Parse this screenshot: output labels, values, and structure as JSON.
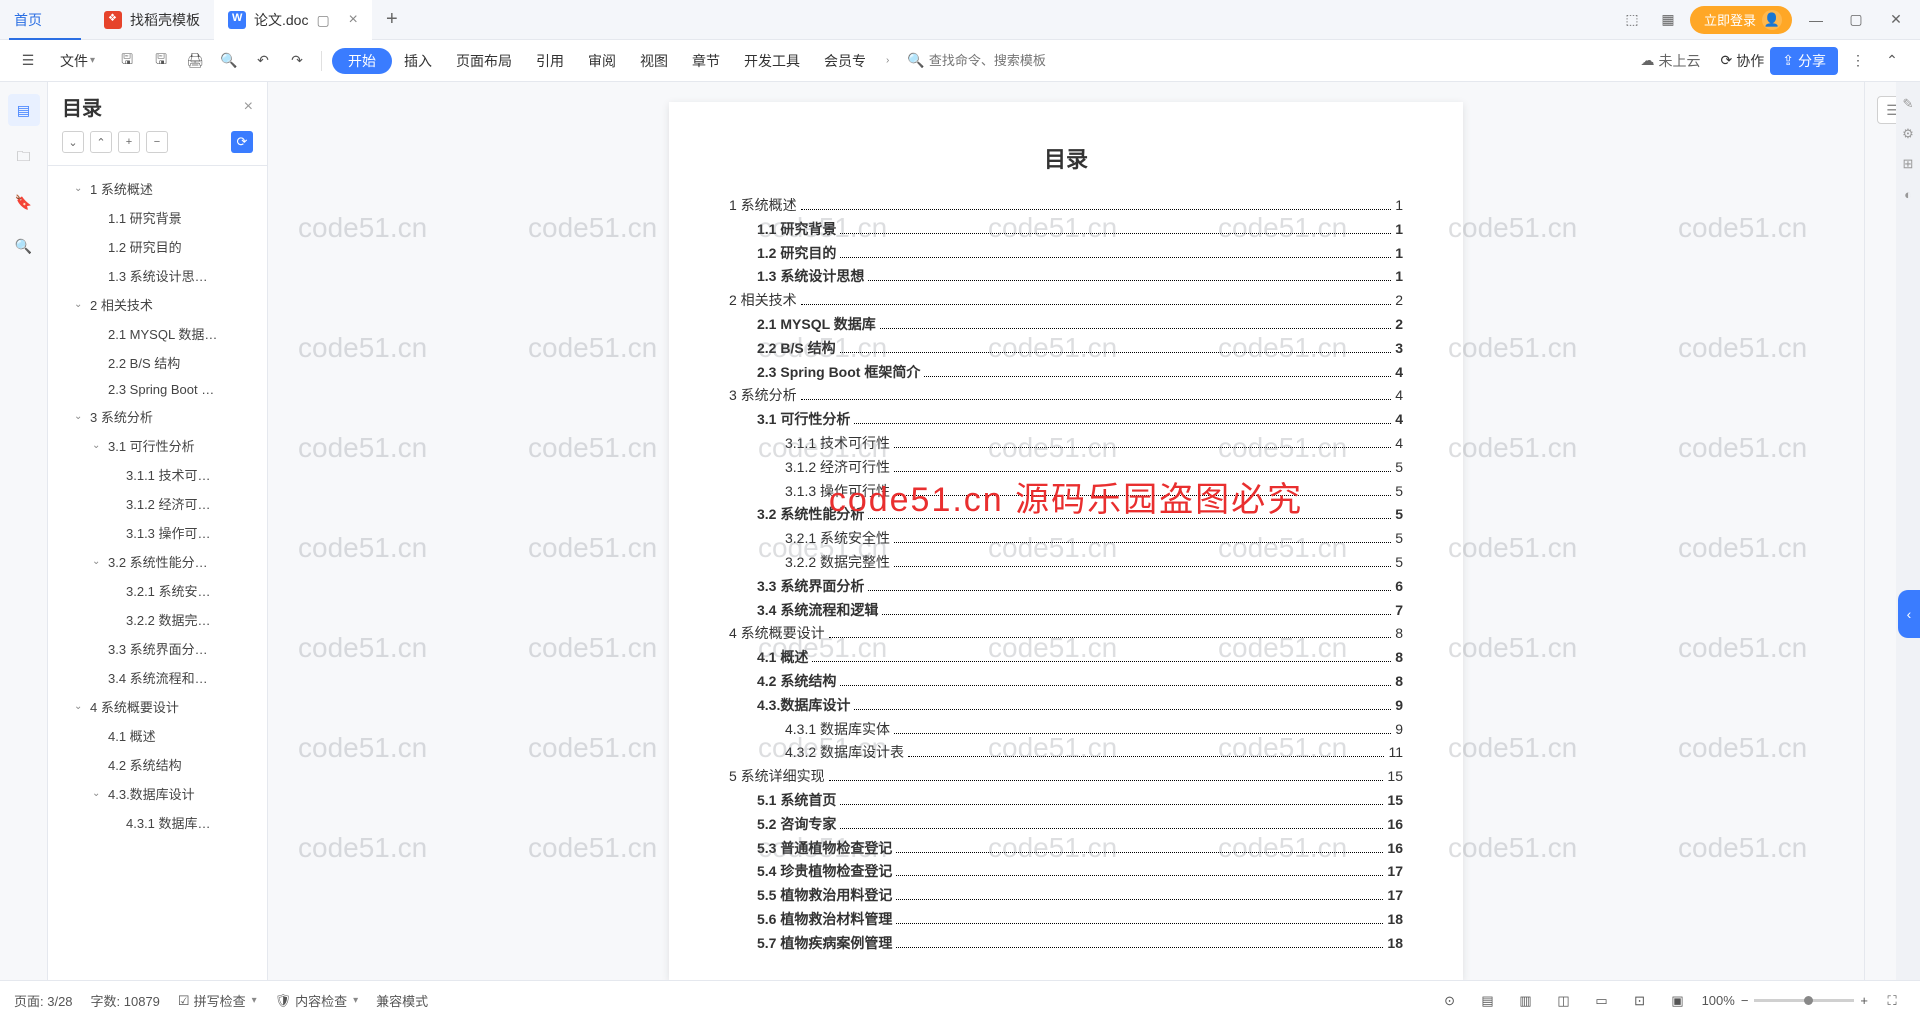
{
  "titlebar": {
    "home": "首页",
    "tab1": "找稻壳模板",
    "tab2": "论文.doc",
    "login": "立即登录"
  },
  "toolbar": {
    "file": "文件",
    "menus": [
      "开始",
      "插入",
      "页面布局",
      "引用",
      "审阅",
      "视图",
      "章节",
      "开发工具",
      "会员专"
    ],
    "search_placeholder": "查找命令、搜索模板",
    "cloud": "未上云",
    "collab": "协作",
    "share": "分享"
  },
  "outline": {
    "title": "目录",
    "items": [
      {
        "lvl": 0,
        "caret": true,
        "text": "1 系统概述"
      },
      {
        "lvl": 1,
        "text": "1.1 研究背景"
      },
      {
        "lvl": 1,
        "text": "1.2 研究目的"
      },
      {
        "lvl": 1,
        "text": "1.3 系统设计思…"
      },
      {
        "lvl": 0,
        "caret": true,
        "text": "2 相关技术"
      },
      {
        "lvl": 1,
        "text": "2.1 MYSQL 数据…"
      },
      {
        "lvl": 1,
        "text": "2.2 B/S 结构"
      },
      {
        "lvl": 1,
        "text": "2.3 Spring Boot …"
      },
      {
        "lvl": 0,
        "caret": true,
        "text": "3 系统分析"
      },
      {
        "lvl": 1,
        "caret": true,
        "text": "3.1 可行性分析"
      },
      {
        "lvl": 2,
        "text": "3.1.1 技术可…"
      },
      {
        "lvl": 2,
        "text": "3.1.2 经济可…"
      },
      {
        "lvl": 2,
        "text": "3.1.3 操作可…"
      },
      {
        "lvl": 1,
        "caret": true,
        "text": "3.2 系统性能分…"
      },
      {
        "lvl": 2,
        "text": "3.2.1 系统安…"
      },
      {
        "lvl": 2,
        "text": "3.2.2 数据完…"
      },
      {
        "lvl": 1,
        "text": "3.3 系统界面分…"
      },
      {
        "lvl": 1,
        "text": "3.4 系统流程和…"
      },
      {
        "lvl": 0,
        "caret": true,
        "text": "4 系统概要设计"
      },
      {
        "lvl": 1,
        "text": "4.1 概述"
      },
      {
        "lvl": 1,
        "text": "4.2 系统结构"
      },
      {
        "lvl": 1,
        "caret": true,
        "text": "4.3.数据库设计"
      },
      {
        "lvl": 2,
        "text": "4.3.1 数据库…"
      }
    ]
  },
  "doc": {
    "title": "目录",
    "toc": [
      {
        "lvl": 1,
        "t": "1 系统概述",
        "p": "1"
      },
      {
        "lvl": 2,
        "t": "1.1 研究背景",
        "p": "1"
      },
      {
        "lvl": 2,
        "t": "1.2 研究目的",
        "p": "1"
      },
      {
        "lvl": 2,
        "t": "1.3 系统设计思想",
        "p": "1"
      },
      {
        "lvl": 1,
        "t": "2 相关技术",
        "p": "2"
      },
      {
        "lvl": 2,
        "t": "2.1 MYSQL 数据库",
        "p": "2"
      },
      {
        "lvl": 2,
        "t": "2.2 B/S 结构",
        "p": "3"
      },
      {
        "lvl": 2,
        "t": "2.3 Spring Boot 框架简介",
        "p": "4"
      },
      {
        "lvl": 1,
        "t": "3 系统分析",
        "p": "4"
      },
      {
        "lvl": 2,
        "t": "3.1 可行性分析",
        "p": "4"
      },
      {
        "lvl": 3,
        "t": "3.1.1 技术可行性",
        "p": "4"
      },
      {
        "lvl": 3,
        "t": "3.1.2 经济可行性",
        "p": "5"
      },
      {
        "lvl": 3,
        "t": "3.1.3 操作可行性",
        "p": "5"
      },
      {
        "lvl": 2,
        "t": "3.2 系统性能分析",
        "p": "5"
      },
      {
        "lvl": 3,
        "t": "3.2.1 系统安全性",
        "p": "5"
      },
      {
        "lvl": 3,
        "t": "3.2.2 数据完整性",
        "p": "5"
      },
      {
        "lvl": 2,
        "t": "3.3 系统界面分析",
        "p": "6"
      },
      {
        "lvl": 2,
        "t": "3.4 系统流程和逻辑",
        "p": "7"
      },
      {
        "lvl": 1,
        "t": "4 系统概要设计",
        "p": "8"
      },
      {
        "lvl": 2,
        "t": "4.1 概述",
        "p": "8"
      },
      {
        "lvl": 2,
        "t": "4.2 系统结构",
        "p": "8"
      },
      {
        "lvl": 2,
        "t": "4.3.数据库设计",
        "p": "9"
      },
      {
        "lvl": 3,
        "t": "4.3.1 数据库实体",
        "p": "9"
      },
      {
        "lvl": 3,
        "t": "4.3.2 数据库设计表",
        "p": "11"
      },
      {
        "lvl": 1,
        "t": "5 系统详细实现",
        "p": "15"
      },
      {
        "lvl": 2,
        "t": "5.1 系统首页",
        "p": "15"
      },
      {
        "lvl": 2,
        "t": "5.2 咨询专家",
        "p": "16"
      },
      {
        "lvl": 2,
        "t": "5.3 普通植物检查登记",
        "p": "16"
      },
      {
        "lvl": 2,
        "t": "5.4 珍贵植物检查登记",
        "p": "17"
      },
      {
        "lvl": 2,
        "t": "5.5 植物救治用料登记",
        "p": "17"
      },
      {
        "lvl": 2,
        "t": "5.6 植物救治材料管理",
        "p": "18"
      },
      {
        "lvl": 2,
        "t": "5.7 植物疾病案例管理",
        "p": "18"
      }
    ]
  },
  "watermark": {
    "text": "code51.cn",
    "red": "code51.cn  源码乐园盗图必究"
  },
  "status": {
    "page": "页面: 3/28",
    "words": "字数: 10879",
    "spell": "拼写检查",
    "content": "内容检查",
    "compat": "兼容模式",
    "zoom": "100%"
  }
}
